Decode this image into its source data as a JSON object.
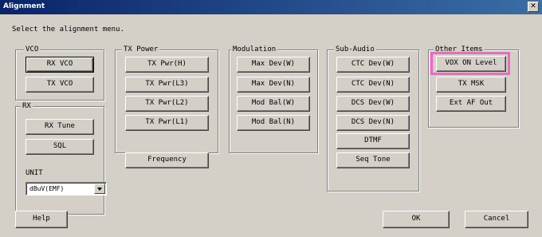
{
  "window": {
    "title": "Alignment",
    "close_label": "✕"
  },
  "prompt": "Select the alignment menu.",
  "groups": {
    "vco": {
      "legend": "VCO",
      "buttons": [
        "RX VCO",
        "TX VCO"
      ]
    },
    "rx": {
      "legend": "RX",
      "buttons": [
        "RX Tune",
        "SQL"
      ],
      "unit_label": "UNIT",
      "unit_value": "dBuV(EMF)"
    },
    "tx_power": {
      "legend": "TX Power",
      "buttons": [
        "TX Pwr(H)",
        "TX Pwr(L3)",
        "TX Pwr(L2)",
        "TX Pwr(L1)"
      ]
    },
    "modulation": {
      "legend": "Modulation",
      "buttons": [
        "Max Dev(W)",
        "Max Dev(N)",
        "Mod Bal(W)",
        "Mod Bal(N)"
      ]
    },
    "sub_audio": {
      "legend": "Sub-Audio",
      "buttons": [
        "CTC Dev(W)",
        "CTC Dev(N)",
        "DCS Dev(W)",
        "DCS Dev(N)",
        "DTMF",
        "Seq Tone"
      ]
    },
    "other": {
      "legend": "Other Items",
      "buttons": [
        "VOX ON Level",
        "TX MSK",
        "Ext AF Out"
      ]
    }
  },
  "frequency_button": "Frequency",
  "footer": {
    "help": "Help",
    "ok": "OK",
    "cancel": "Cancel"
  },
  "colors": {
    "highlight": "#ff5fc8",
    "titlebar": "#0a246a"
  }
}
